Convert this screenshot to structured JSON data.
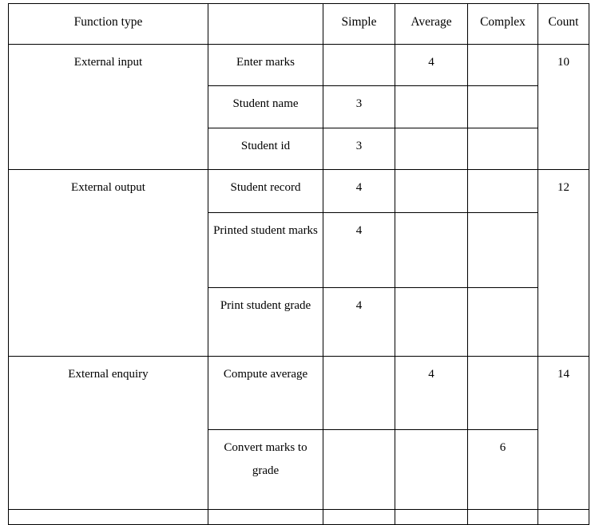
{
  "table": {
    "caption": "",
    "headers": {
      "function_type": "Function type",
      "function_name": "",
      "simple": "Simple",
      "average": "Average",
      "complex": "Complex",
      "count": "Count"
    },
    "groups": [
      {
        "function_type": "External input",
        "count": "10",
        "rows": [
          {
            "name": "Enter marks",
            "simple": "",
            "average": "4",
            "complex": ""
          },
          {
            "name": "Student name",
            "simple": "3",
            "average": "",
            "complex": ""
          },
          {
            "name": "Student id",
            "simple": "3",
            "average": "",
            "complex": ""
          }
        ]
      },
      {
        "function_type": "External output",
        "count": "12",
        "rows": [
          {
            "name": "Student record",
            "simple": "4",
            "average": "",
            "complex": ""
          },
          {
            "name": "Printed student marks",
            "simple": "4",
            "average": "",
            "complex": ""
          },
          {
            "name": "Print student grade",
            "simple": "4",
            "average": "",
            "complex": ""
          }
        ]
      },
      {
        "function_type": "External enquiry",
        "count": "14",
        "rows": [
          {
            "name": "Compute average",
            "simple": "",
            "average": "4",
            "complex": ""
          },
          {
            "name": "Convert marks to grade",
            "simple": "",
            "average": "",
            "complex": "6"
          }
        ]
      }
    ],
    "partial_row": {
      "function_type": "",
      "name": "",
      "simple": "",
      "average": "",
      "complex": "",
      "count": ""
    }
  }
}
